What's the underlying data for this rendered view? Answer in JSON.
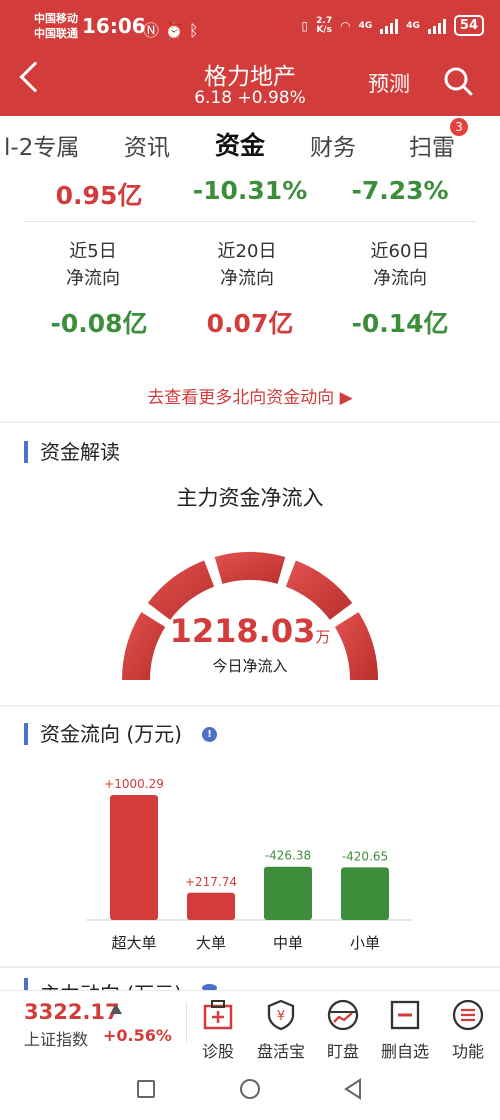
{
  "status_bar": {
    "carrier1": "中国移动",
    "carrier2": "中国联通",
    "time": "16:06",
    "net_speed_top": "2.7",
    "net_speed_bottom": "K/s",
    "signal1": "4G",
    "signal2": "4G",
    "battery": "54"
  },
  "header": {
    "title": "格力地产",
    "subtitle": "6.18 +0.98%",
    "predict_label": "预测"
  },
  "tabs": [
    {
      "label": "l-2专属"
    },
    {
      "label": "资讯"
    },
    {
      "label": "资金"
    },
    {
      "label": "财务"
    },
    {
      "label": "扫雷"
    }
  ],
  "tab_badge": "3",
  "flow_top": [
    {
      "value": "0.95亿",
      "color": "red"
    },
    {
      "value": "-10.31%",
      "color": "green"
    },
    {
      "value": "-7.23%",
      "color": "green"
    }
  ],
  "flow_items": [
    {
      "line1": "近5日",
      "line2": "净流向",
      "value": "-0.08亿"
    },
    {
      "line1": "近20日",
      "line2": "净流向",
      "value": "0.07亿"
    },
    {
      "line1": "近60日",
      "line2": "净流向",
      "value": "-0.14亿"
    }
  ],
  "north_link": "去查看更多北向资金动向 ▶",
  "section1": {
    "title": "资金解读"
  },
  "gauge": {
    "title": "主力资金净流入",
    "value": "1218.03",
    "unit": "万",
    "sub": "今日净流入"
  },
  "section2": {
    "title": "资金流向 (万元)"
  },
  "chart_data": {
    "type": "bar",
    "title": "资金流向 (万元)",
    "categories": [
      "超大单",
      "大单",
      "中单",
      "小单"
    ],
    "values": [
      1000.29,
      217.74,
      -426.38,
      -420.65
    ],
    "value_labels": [
      "+1000.29",
      "+217.74",
      "-426.38",
      "-420.65"
    ],
    "xlabel": "",
    "ylabel": "",
    "colors": {
      "positive": "#d23c3a",
      "negative": "#3d8e3a"
    }
  },
  "section3_partial": "主力动向 (万元)",
  "index": {
    "value": "3322.17",
    "name": "上证指数",
    "change": "+0.56%"
  },
  "toolbar": [
    {
      "label": "诊股",
      "icon": "medical-box-icon"
    },
    {
      "label": "盘活宝",
      "icon": "shield-yen-icon"
    },
    {
      "label": "盯盘",
      "icon": "chart-circle-icon"
    },
    {
      "label": "删自选",
      "icon": "minus-box-icon"
    },
    {
      "label": "功能",
      "icon": "menu-circle-icon"
    }
  ],
  "colors": {
    "brand": "#d23c3a",
    "up": "#d23c3a",
    "down": "#3d8e3a",
    "accent": "#4a72c8"
  }
}
